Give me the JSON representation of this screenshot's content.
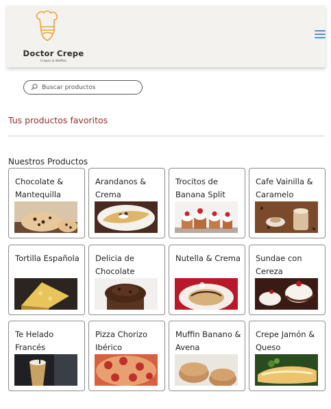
{
  "brand": {
    "name": "Doctor Crepe",
    "tagline": "Crepes & Waffles",
    "accent_color": "#e8a33a"
  },
  "menu_icon": "hamburger-menu-icon",
  "search": {
    "placeholder": "Buscar productos",
    "value": "",
    "icon": "search-icon"
  },
  "favorites": {
    "title": "Tus productos favoritos"
  },
  "products": {
    "title": "Nuestros Productos",
    "items": [
      {
        "name": "Chocolate & Mantequilla"
      },
      {
        "name": "Arandanos & Crema"
      },
      {
        "name": "Trocitos de Banana Split"
      },
      {
        "name": "Cafe Vainilla & Caramelo"
      },
      {
        "name": "Tortilla Española"
      },
      {
        "name": "Delicia de Chocolate"
      },
      {
        "name": "Nutella & Crema"
      },
      {
        "name": "Sundae con Cereza"
      },
      {
        "name": "Te Helado Francés"
      },
      {
        "name": "Pizza Chorizo Ibérico"
      },
      {
        "name": "Muffin Banano & Avena"
      },
      {
        "name": "Crepe Jamón & Queso"
      }
    ]
  }
}
